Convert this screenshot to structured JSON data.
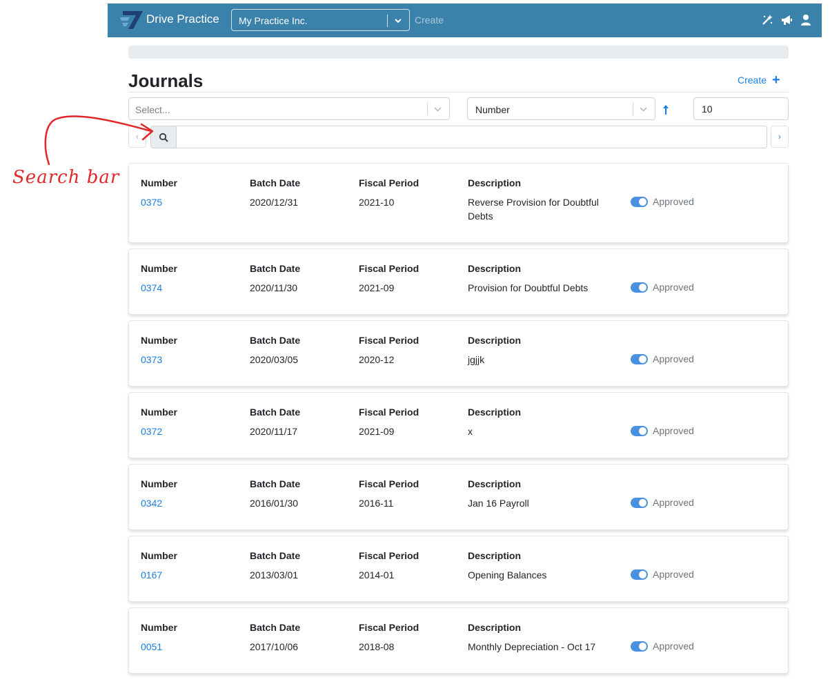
{
  "nav": {
    "brand": "Drive Practice",
    "practice_selected": "My Practice Inc.",
    "create_label": "Create",
    "icons": [
      "magic-wand-icon",
      "megaphone-icon",
      "user-icon"
    ],
    "bg_color": "#3b82ab"
  },
  "page": {
    "title": "Journals",
    "create_label": "Create",
    "filter_placeholder": "Select...",
    "sort_field": "Number",
    "sort_direction": "ascending",
    "page_size": "10",
    "search_value": "",
    "accent_color": "#1a7ee0"
  },
  "annotation": {
    "label": "Search bar",
    "color": "#e3262a"
  },
  "columns": {
    "number": "Number",
    "batch_date": "Batch Date",
    "fiscal_period": "Fiscal Period",
    "description": "Description"
  },
  "journals": [
    {
      "number": "0375",
      "batch_date": "2020/12/31",
      "fiscal_period": "2021-10",
      "description": "Reverse Provision for Doubtful Debts",
      "status": "Approved",
      "approved": true
    },
    {
      "number": "0374",
      "batch_date": "2020/11/30",
      "fiscal_period": "2021-09",
      "description": "Provision for Doubtful Debts",
      "status": "Approved",
      "approved": true
    },
    {
      "number": "0373",
      "batch_date": "2020/03/05",
      "fiscal_period": "2020-12",
      "description": "jgjjk",
      "status": "Approved",
      "approved": true
    },
    {
      "number": "0372",
      "batch_date": "2020/11/17",
      "fiscal_period": "2021-09",
      "description": "x",
      "status": "Approved",
      "approved": true
    },
    {
      "number": "0342",
      "batch_date": "2016/01/30",
      "fiscal_period": "2016-11",
      "description": "Jan 16 Payroll",
      "status": "Approved",
      "approved": true
    },
    {
      "number": "0167",
      "batch_date": "2013/03/01",
      "fiscal_period": "2014-01",
      "description": "Opening Balances",
      "status": "Approved",
      "approved": true
    },
    {
      "number": "0051",
      "batch_date": "2017/10/06",
      "fiscal_period": "2018-08",
      "description": "Monthly Depreciation - Oct 17",
      "status": "Approved",
      "approved": true
    }
  ]
}
